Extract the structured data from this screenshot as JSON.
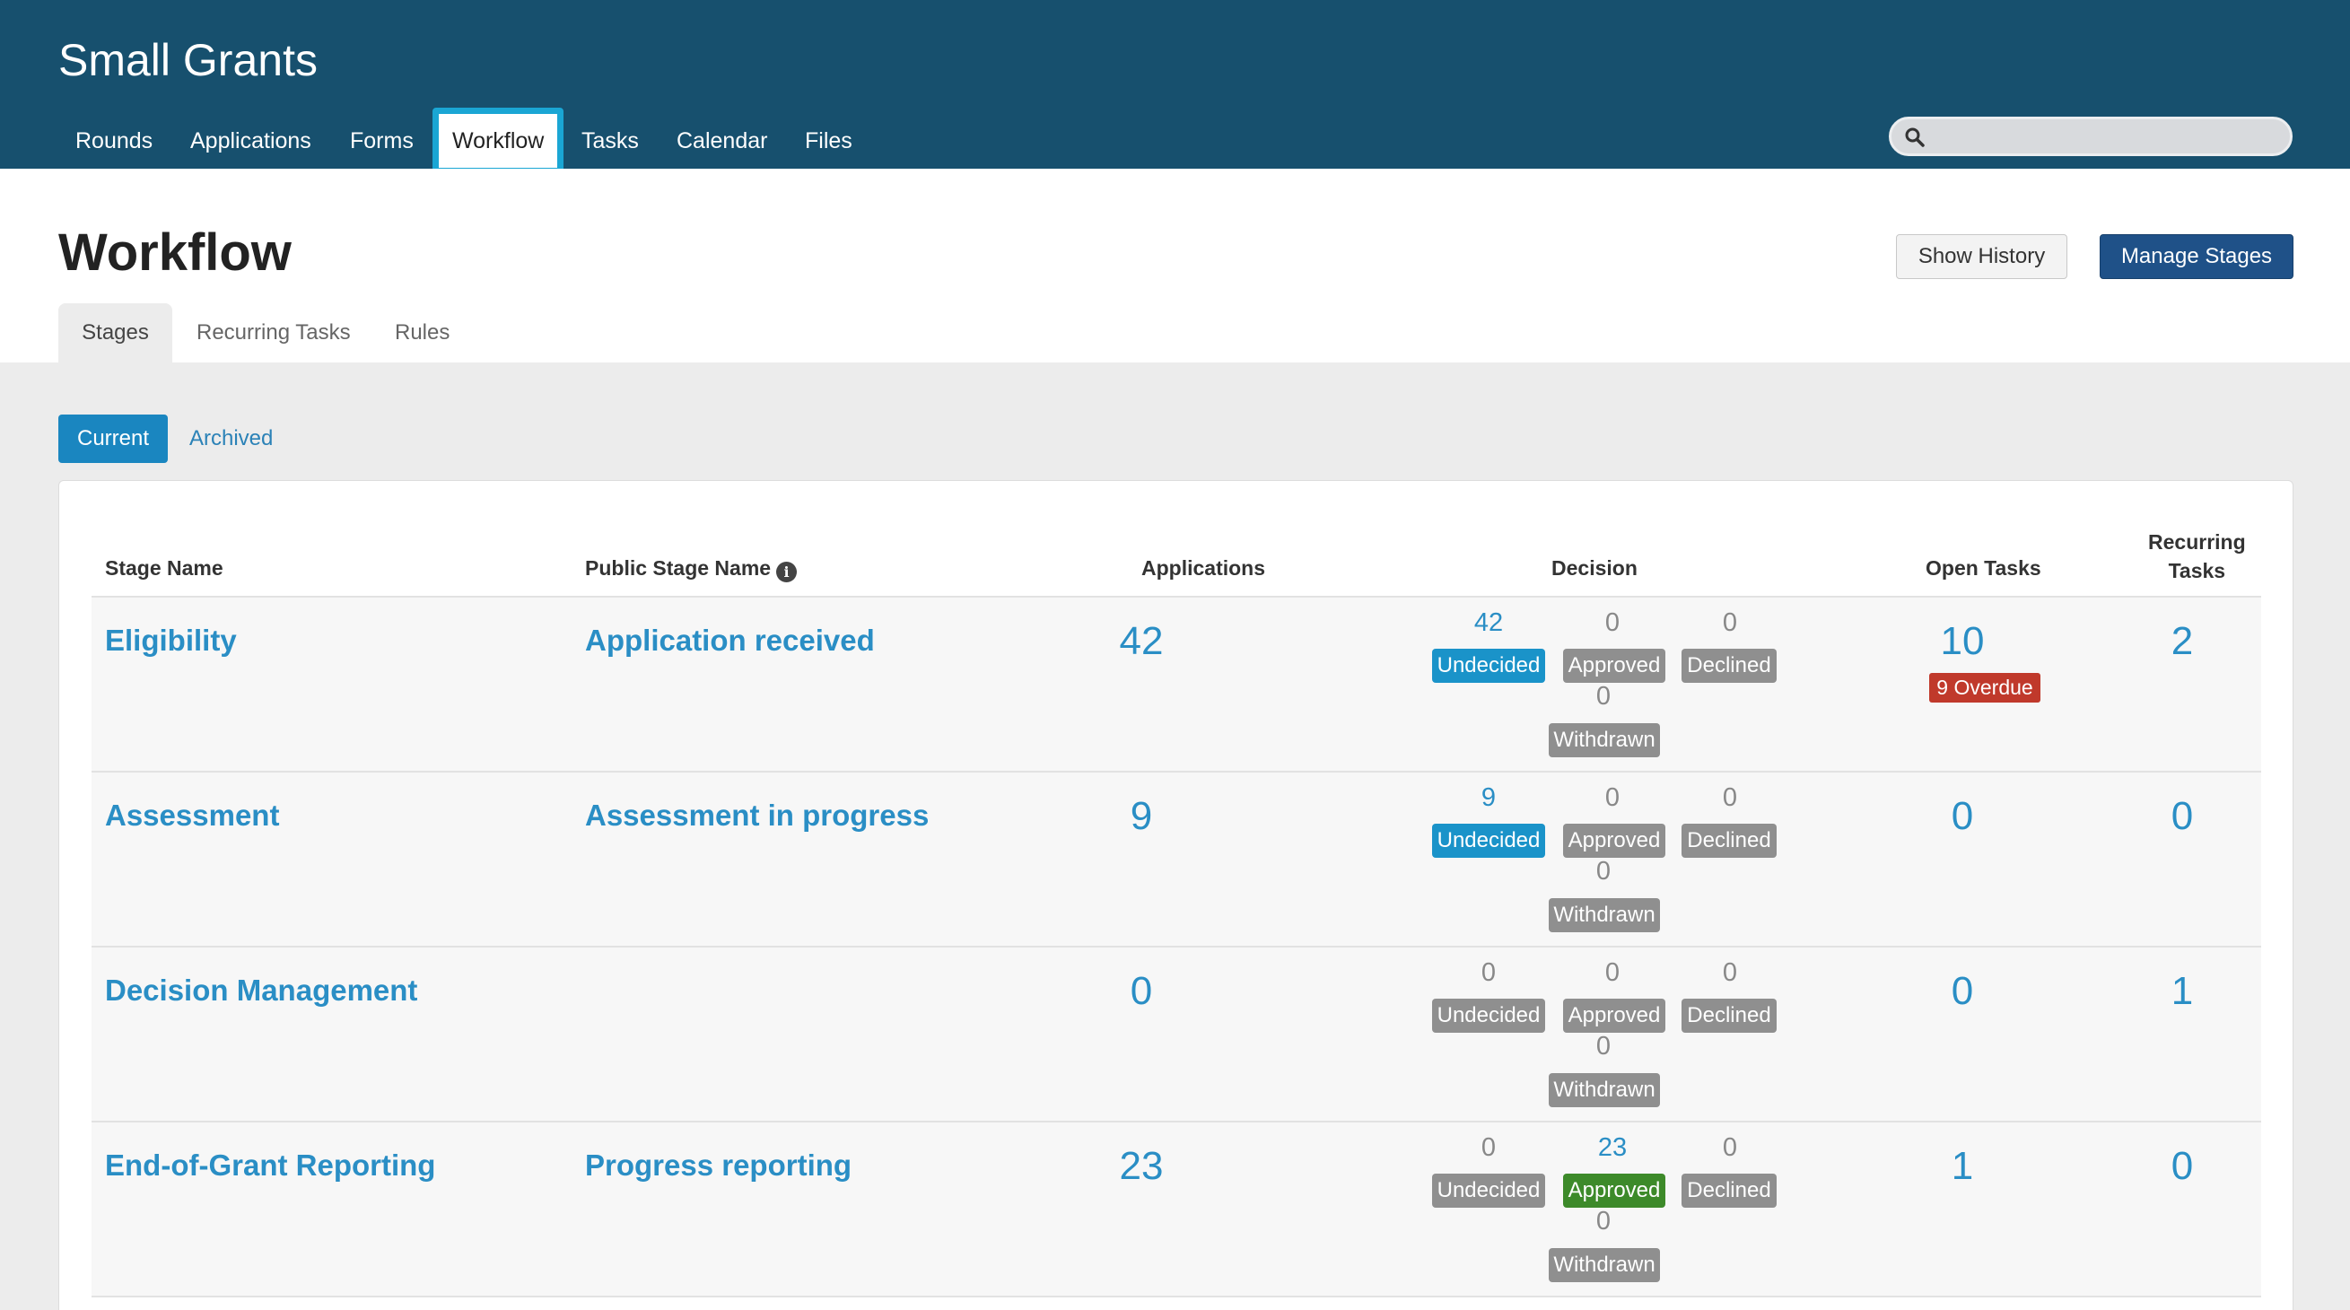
{
  "app": {
    "title": "Small Grants"
  },
  "nav": {
    "items": [
      {
        "label": "Rounds"
      },
      {
        "label": "Applications"
      },
      {
        "label": "Forms"
      },
      {
        "label": "Workflow"
      },
      {
        "label": "Tasks"
      },
      {
        "label": "Calendar"
      },
      {
        "label": "Files"
      }
    ],
    "active": "Workflow"
  },
  "search": {
    "placeholder": "",
    "icon": "search-icon"
  },
  "page": {
    "title": "Workflow",
    "show_history_label": "Show History",
    "manage_stages_label": "Manage Stages",
    "tabs": [
      {
        "label": "Stages"
      },
      {
        "label": "Recurring Tasks"
      },
      {
        "label": "Rules"
      }
    ],
    "filters": [
      {
        "label": "Current"
      },
      {
        "label": "Archived"
      }
    ]
  },
  "table": {
    "headers": {
      "stage_name": "Stage Name",
      "public_stage_name": "Public Stage Name",
      "applications": "Applications",
      "decision": "Decision",
      "open_tasks": "Open Tasks",
      "recurring_tasks_line1": "Recurring",
      "recurring_tasks_line2": "Tasks"
    },
    "decision_labels": {
      "undecided": "Undecided",
      "approved": "Approved",
      "declined": "Declined",
      "withdrawn": "Withdrawn"
    },
    "rows": [
      {
        "stage": "Eligibility",
        "public": "Application received",
        "applications": "42",
        "undecided": "42",
        "approved": "0",
        "declined": "0",
        "withdrawn": "0",
        "open_tasks": "10",
        "overdue": "9 Overdue",
        "recurring": "2"
      },
      {
        "stage": "Assessment",
        "public": "Assessment in progress",
        "applications": "9",
        "undecided": "9",
        "approved": "0",
        "declined": "0",
        "withdrawn": "0",
        "open_tasks": "0",
        "recurring": "0"
      },
      {
        "stage": "Decision Management",
        "public": "",
        "applications": "0",
        "undecided": "0",
        "approved": "0",
        "declined": "0",
        "withdrawn": "0",
        "open_tasks": "0",
        "recurring": "1"
      },
      {
        "stage": "End-of-Grant Reporting",
        "public": "Progress reporting",
        "applications": "23",
        "undecided": "0",
        "approved": "23",
        "declined": "0",
        "withdrawn": "0",
        "open_tasks": "1",
        "recurring": "0"
      }
    ]
  },
  "colors": {
    "header_bg": "#17506e",
    "accent": "#2a8ec5",
    "active_tab_border": "#1aa6d4",
    "overdue": "#c0392b",
    "approved": "#3d8a2a",
    "undecided": "#1a93c9"
  }
}
